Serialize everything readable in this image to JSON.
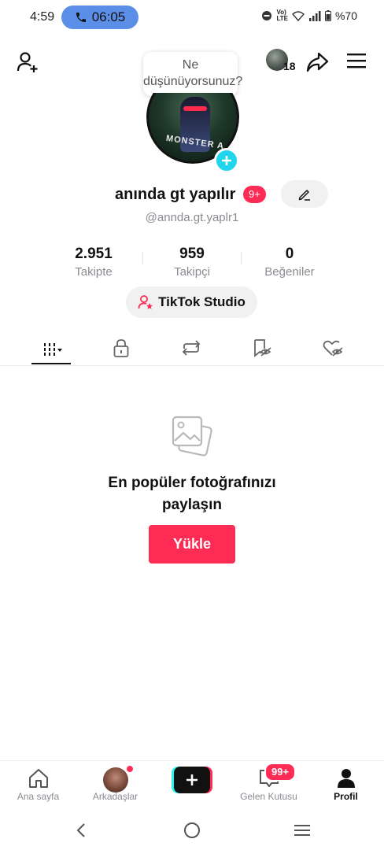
{
  "status_bar": {
    "time": "4:59",
    "call_time": "06:05",
    "network": "VoLTE LTE",
    "battery": "%70"
  },
  "top_bar": {
    "thought_bubble": "Ne düşünüyorsunuz?",
    "viewers_count": "18"
  },
  "profile": {
    "avatar_text": "MONSTER A",
    "name": "anında gt yapılır",
    "name_badge": "9+",
    "handle": "@annda.gt.yaplr1",
    "stats": [
      {
        "value": "2.951",
        "label": "Takipte"
      },
      {
        "value": "959",
        "label": "Takipçi"
      },
      {
        "value": "0",
        "label": "Beğeniler"
      }
    ],
    "studio_button": "TikTok Studio"
  },
  "tabs": [
    {
      "name": "videos-grid-icon",
      "active": true
    },
    {
      "name": "private-lock-icon",
      "active": false
    },
    {
      "name": "reposts-icon",
      "active": false
    },
    {
      "name": "saved-hidden-icon",
      "active": false
    },
    {
      "name": "liked-hidden-icon",
      "active": false
    }
  ],
  "empty_state": {
    "title": "En popüler fotoğrafınızı paylaşın",
    "upload_button": "Yükle"
  },
  "bottom_nav": {
    "home": "Ana sayfa",
    "friends": "Arkadaşlar",
    "inbox": "Gelen Kutusu",
    "inbox_badge": "99+",
    "profile": "Profil"
  },
  "colors": {
    "accent": "#fe2c55",
    "cyan": "#25f4ee",
    "call_pill": "#5b8ee6"
  }
}
